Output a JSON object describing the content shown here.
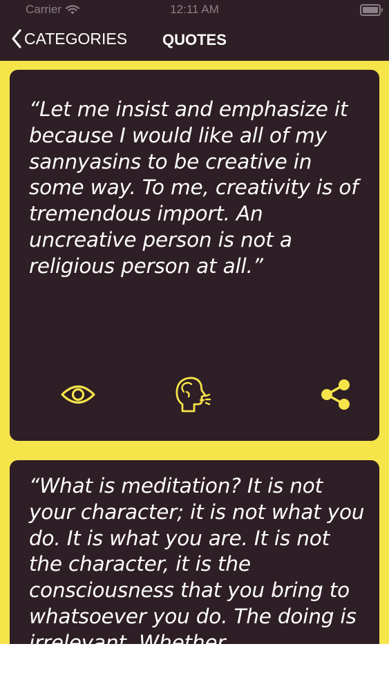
{
  "status_bar": {
    "carrier": "Carrier",
    "time": "12:11 AM"
  },
  "nav": {
    "back_label": "CATEGORIES",
    "title": "QUOTES"
  },
  "quotes": [
    {
      "text": "“Let me insist and emphasize it because I would like all of my sannyasins to be creative in some way. To me, creativity is of tremendous import. An uncreative person is not a religious person at all.”",
      "actions": [
        "eye-icon",
        "speaking-head-icon",
        "share-icon"
      ]
    },
    {
      "text": "“What is meditation? It is not your character; it is not what you do. It is what you are. It is not the character, it is the consciousness that you bring to whatsoever you do. The doing is irrelevant. Whether"
    }
  ],
  "colors": {
    "background_yellow": "#f6e44b",
    "card_dark": "#2e1e25",
    "icon_yellow": "#f6e44b",
    "text_white": "#ffffff"
  }
}
